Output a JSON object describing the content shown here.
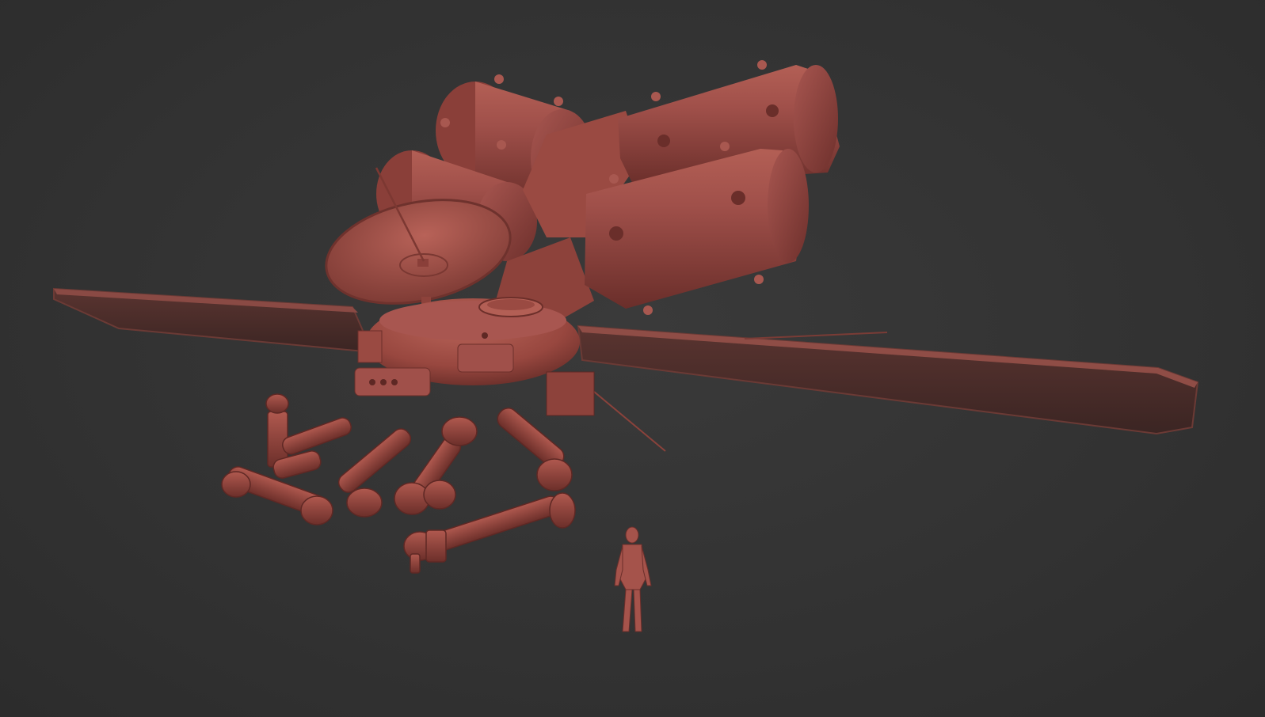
{
  "scene": {
    "background_color": "#333333",
    "model_color": "#9a4a42",
    "model_highlight": "#b45e55",
    "model_shadow": "#5a2622",
    "panel_color": "#3e2a28",
    "subjects": [
      "satellite-probe",
      "solar-panel-left",
      "solar-panel-right",
      "dish-antenna",
      "propellant-tanks",
      "robotic-arms",
      "human-scale-figure"
    ]
  }
}
